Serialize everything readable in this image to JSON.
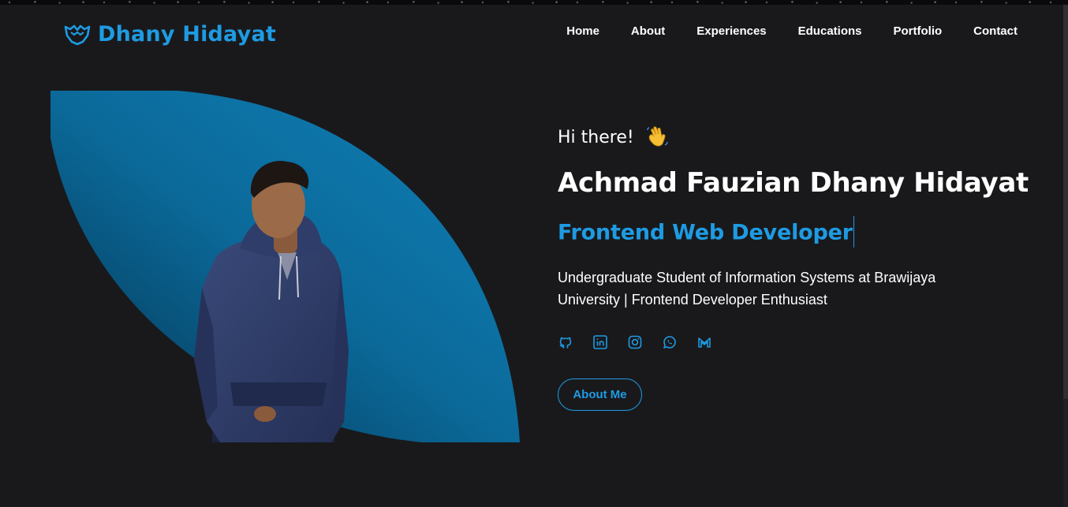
{
  "brand": {
    "name": "Dhany Hidayat",
    "icon": "bat-logo-icon"
  },
  "nav": {
    "items": [
      "Home",
      "About",
      "Experiences",
      "Educations",
      "Portfolio",
      "Contact"
    ]
  },
  "hero": {
    "greeting": "Hi there!",
    "greeting_emoji": "waving-hand-icon",
    "name": "Achmad Fauzian Dhany Hidayat",
    "role": "Frontend Web Developer",
    "description": "Undergraduate Student of Information Systems at Brawijaya University | Frontend Developer Enthusiast",
    "cta_label": "About Me",
    "socials": [
      "github-icon",
      "linkedin-icon",
      "instagram-icon",
      "whatsapp-icon",
      "gmail-icon"
    ]
  },
  "colors": {
    "background": "#19191c",
    "accent": "#1e9be2",
    "text": "#ffffff"
  }
}
